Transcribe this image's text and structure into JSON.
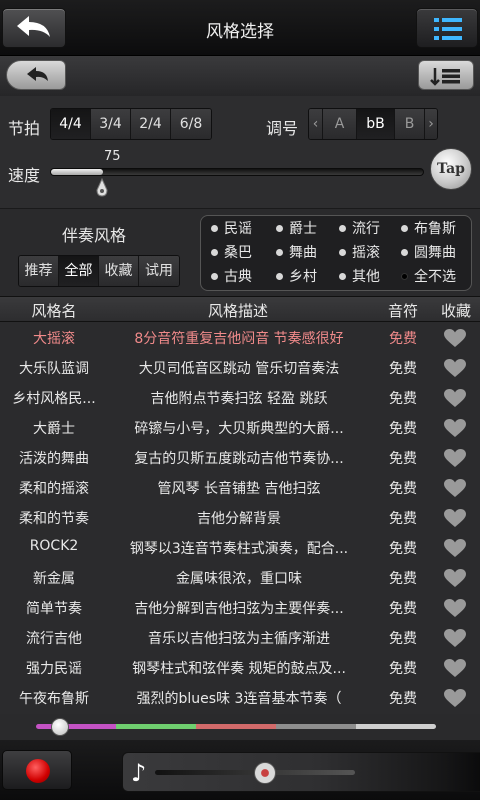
{
  "header": {
    "title": "风格选择",
    "back_icon": "back-arrow-icon",
    "menu_icon": "list-menu-icon"
  },
  "toolbar": {
    "undo_icon": "undo-icon",
    "sort_icon": "sort-list-icon"
  },
  "settings": {
    "beat_label": "节拍",
    "beats": [
      "4/4",
      "3/4",
      "2/4",
      "6/8"
    ],
    "beat_selected": "4/4",
    "key_label": "调号",
    "key_prev": "‹",
    "key_options": [
      "A",
      "bB",
      "B"
    ],
    "key_next": "›",
    "key_selected": "bB",
    "tempo_label": "速度",
    "tempo_value": "75",
    "tempo_level": 0.14,
    "tap_label": "Tap"
  },
  "style": {
    "title": "伴奏风格",
    "filters": [
      "推荐",
      "全部",
      "收藏",
      "试用"
    ],
    "filter_selected": "全部",
    "genres": [
      {
        "label": "民谣",
        "dot": "white"
      },
      {
        "label": "爵士",
        "dot": "white"
      },
      {
        "label": "流行",
        "dot": "white"
      },
      {
        "label": "布鲁斯",
        "dot": "white"
      },
      {
        "label": "桑巴",
        "dot": "white"
      },
      {
        "label": "舞曲",
        "dot": "white"
      },
      {
        "label": "摇滚",
        "dot": "white"
      },
      {
        "label": "圆舞曲",
        "dot": "white"
      },
      {
        "label": "古典",
        "dot": "white"
      },
      {
        "label": "乡村",
        "dot": "white"
      },
      {
        "label": "其他",
        "dot": "white"
      },
      {
        "label": "全不选",
        "dot": "black"
      }
    ]
  },
  "table": {
    "headers": {
      "name": "风格名",
      "desc": "风格描述",
      "price": "音符",
      "fav": "收藏"
    },
    "rows": [
      {
        "name": "大摇滚",
        "desc": "8分音符重复吉他闷音 节奏感很好",
        "price": "免费",
        "highlight": true
      },
      {
        "name": "大乐队蓝调",
        "desc": "大贝司低音区跳动 管乐切音奏法",
        "price": "免费",
        "highlight": false
      },
      {
        "name": "乡村风格民...",
        "desc": "吉他附点节奏扫弦 轻盈 跳跃",
        "price": "免费",
        "highlight": false
      },
      {
        "name": "大爵士",
        "desc": "碎镲与小号，大贝斯典型的大爵...",
        "price": "免费",
        "highlight": false
      },
      {
        "name": "活泼的舞曲",
        "desc": "复古的贝斯五度跳动吉他节奏协...",
        "price": "免费",
        "highlight": false
      },
      {
        "name": "柔和的摇滚",
        "desc": "管风琴 长音铺垫 吉他扫弦",
        "price": "免费",
        "highlight": false
      },
      {
        "name": "柔和的节奏",
        "desc": "吉他分解背景",
        "price": "免费",
        "highlight": false
      },
      {
        "name": "ROCK2",
        "desc": "钢琴以3连音节奏柱式演奏，配合...",
        "price": "免费",
        "highlight": false
      },
      {
        "name": "新金属",
        "desc": "金属味很浓，重口味",
        "price": "免费",
        "highlight": false
      },
      {
        "name": "简单节奏",
        "desc": "吉他分解到吉他扫弦为主要伴奏...",
        "price": "免费",
        "highlight": false
      },
      {
        "name": "流行吉他",
        "desc": "音乐以吉他扫弦为主循序渐进",
        "price": "免费",
        "highlight": false
      },
      {
        "name": "强力民谣",
        "desc": "钢琴柱式和弦伴奏 规矩的鼓点及...",
        "price": "免费",
        "highlight": false
      },
      {
        "name": "午夜布鲁斯",
        "desc": "强烈的blues味 3连音基本节奏（",
        "price": "免费",
        "highlight": false
      }
    ],
    "fav_icon": "heart-icon"
  },
  "bottom": {
    "record_icon": "record-icon",
    "note_icon": "music-note-icon",
    "note_glyph": "♪",
    "progress_level": 0.06,
    "volume_level": 0.55
  },
  "colors": {
    "highlight_text": "#f08a8a",
    "record_red": "#d00000"
  }
}
